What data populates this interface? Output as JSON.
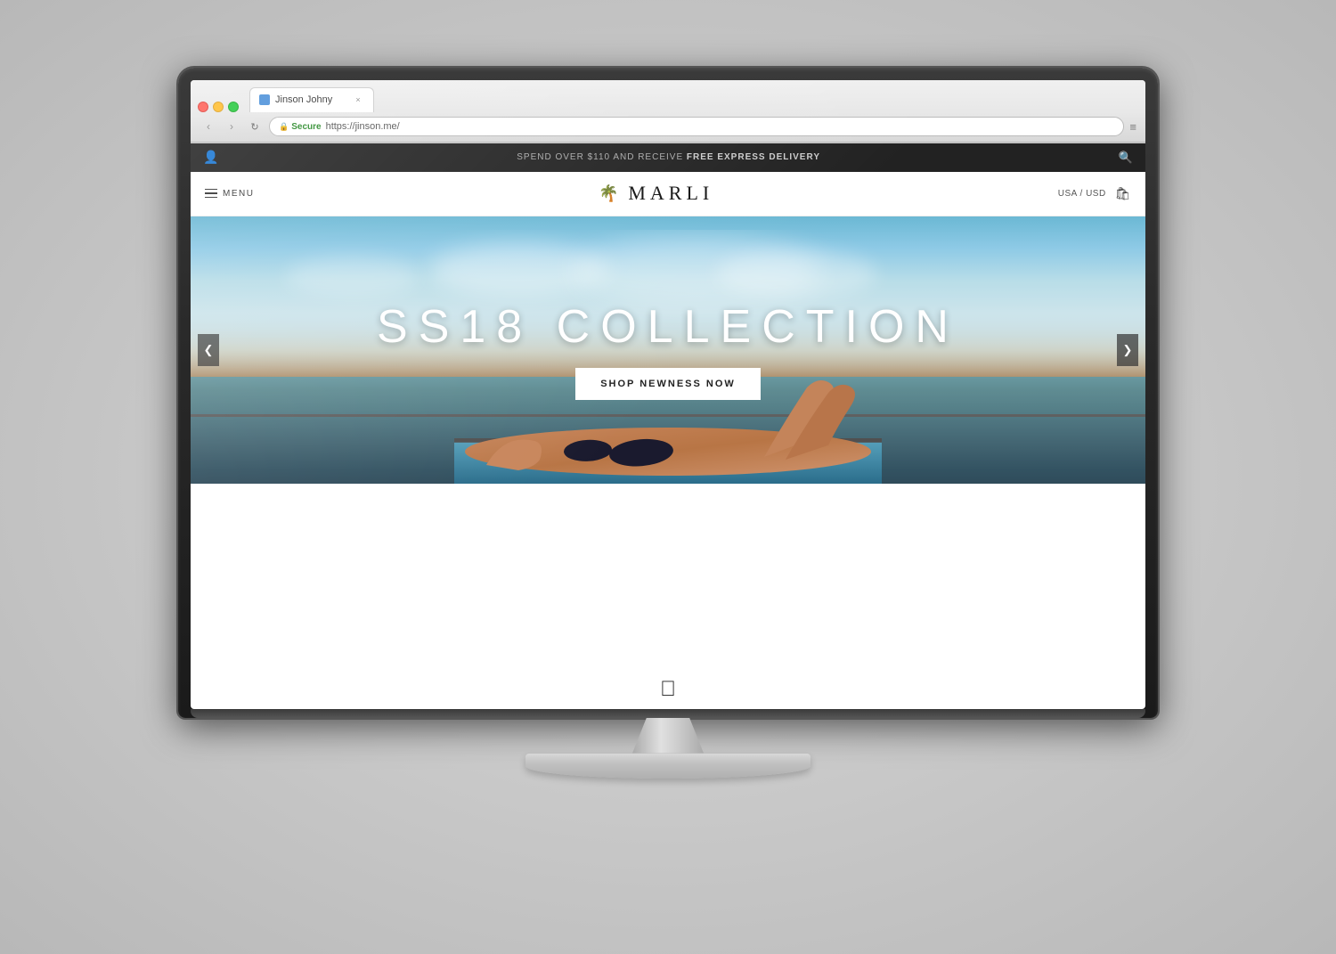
{
  "browser": {
    "tab_label": "Jinson Johny",
    "tab_close": "×",
    "nav_back": "‹",
    "nav_forward": "›",
    "nav_refresh": "↻",
    "secure_label": "Secure",
    "url": "https://jinson.me/",
    "menu_icon": "≡"
  },
  "website": {
    "announcement": {
      "text": "SPEND OVER $110 AND RECEIVE ",
      "bold_text": "FREE EXPRESS DELIVERY"
    },
    "nav": {
      "menu_label": "MENU",
      "brand_name": "MARLI",
      "locale": "USA / USD"
    },
    "hero": {
      "title": "SS18 COLLECTION",
      "cta_label": "SHOP NEWNESS NOW",
      "carousel_left": "❮",
      "carousel_right": "❯"
    }
  },
  "monitor": {
    "apple_logo": ""
  }
}
